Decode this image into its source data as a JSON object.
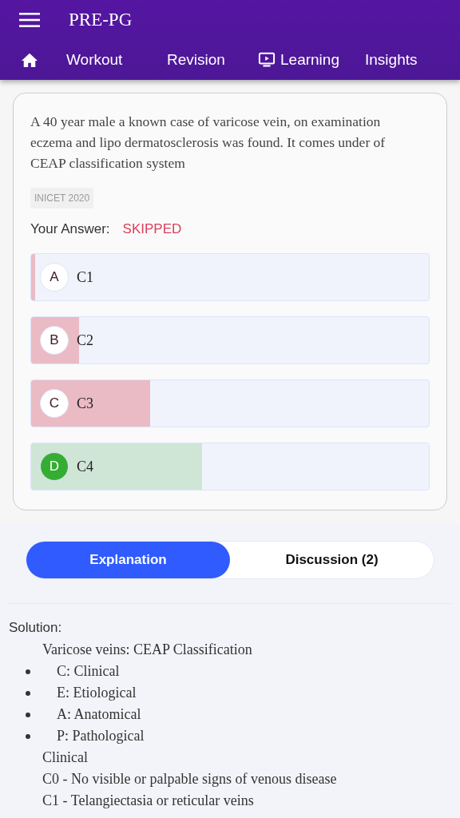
{
  "app_bar": {
    "title": "PRE-PG"
  },
  "nav": [
    {
      "kind": "home"
    },
    {
      "kind": "text",
      "label": "Workout"
    },
    {
      "kind": "text",
      "label": "Revision"
    },
    {
      "kind": "tv",
      "label": "Learning"
    },
    {
      "kind": "text",
      "label": "Insights"
    }
  ],
  "question": {
    "text": "A 40 year male a known case of varicose vein, on examination eczema and lipo dermatosclerosis was found. It comes under of CEAP classification system",
    "tag": "INICET 2020",
    "answer_label": "Your Answer:",
    "answer_value": "SKIPPED"
  },
  "options": [
    {
      "letter": "A",
      "text": "C1",
      "correct": false,
      "level": 0.01
    },
    {
      "letter": "B",
      "text": "C2",
      "correct": false,
      "level": 0.12
    },
    {
      "letter": "C",
      "text": "C3",
      "correct": false,
      "level": 0.3
    },
    {
      "letter": "D",
      "text": "C4",
      "correct": true,
      "level": 0.43
    }
  ],
  "tabs": [
    {
      "label": "Explanation",
      "selected": true
    },
    {
      "label": "Discussion (2)",
      "selected": false
    }
  ],
  "explanation": {
    "heading": "Solution:",
    "blocks": [
      {
        "kind": "paragraph",
        "text": "Varicose veins: CEAP Classification"
      },
      {
        "kind": "bullet",
        "text": "C: Clinical"
      },
      {
        "kind": "bullet",
        "text": "E: Etiological"
      },
      {
        "kind": "bullet",
        "text": "A: Anatomical"
      },
      {
        "kind": "bullet",
        "text": "P: Pathological"
      },
      {
        "kind": "paragraph",
        "text": "Clinical"
      },
      {
        "kind": "paragraph",
        "text": "C0 - No visible or palpable signs of venous disease"
      },
      {
        "kind": "paragraph",
        "text": "C1 - Telangiectasia or reticular veins"
      }
    ]
  }
}
